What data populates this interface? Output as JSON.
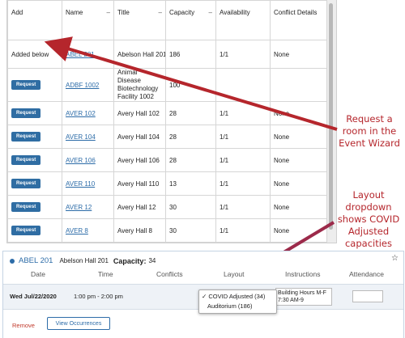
{
  "table": {
    "headers": [
      "Add",
      "Name",
      "Title",
      "Capacity",
      "Availability",
      "Conflict Details"
    ],
    "sort_marker": "–",
    "rows": [
      {
        "add": "Added below",
        "name": "ABEL 201",
        "title": "Abelson Hall 201",
        "capacity": "186",
        "availability": "1/1",
        "conflict": "None"
      },
      {
        "add": "Request",
        "name": "ADBF 1002",
        "title": "Animal Disease Biotechnology Facility 1002",
        "capacity": "100",
        "availability": "",
        "conflict": ""
      },
      {
        "add": "Request",
        "name": "AVER 102",
        "title": "Avery Hall 102",
        "capacity": "28",
        "availability": "1/1",
        "conflict": "None"
      },
      {
        "add": "Request",
        "name": "AVER 104",
        "title": "Avery Hall 104",
        "capacity": "28",
        "availability": "1/1",
        "conflict": "None"
      },
      {
        "add": "Request",
        "name": "AVER 106",
        "title": "Avery Hall 106",
        "capacity": "28",
        "availability": "1/1",
        "conflict": "None"
      },
      {
        "add": "Request",
        "name": "AVER 110",
        "title": "Avery Hall 110",
        "capacity": "13",
        "availability": "1/1",
        "conflict": "None"
      },
      {
        "add": "Request",
        "name": "AVER 12",
        "title": "Avery Hall 12",
        "capacity": "30",
        "availability": "1/1",
        "conflict": "None"
      },
      {
        "add": "Request",
        "name": "AVER 8",
        "title": "Avery Hall 8",
        "capacity": "30",
        "availability": "1/1",
        "conflict": "None"
      }
    ]
  },
  "annotations": {
    "request_note": "Request a room in the Event Wizard",
    "layout_note": "Layout dropdown shows COVID Adjusted capacities",
    "color": "#b5262c"
  },
  "selected": {
    "room": "ABEL 201",
    "title": "Abelson Hall 201",
    "capacity_label": "Capacity:",
    "capacity_value": "34",
    "columns": [
      "Date",
      "Time",
      "Conflicts",
      "Layout",
      "Instructions",
      "Attendance"
    ],
    "date": "Wed Jul/22/2020",
    "time": "1:00 pm - 2:00 pm",
    "instructions": "Building Hours M-F 7:30 AM-9",
    "layout_options": [
      {
        "label": "COVID Adjusted (34)",
        "selected": true,
        "mark": "✓"
      },
      {
        "label": "Auditorium (186)",
        "selected": false
      }
    ],
    "remove_label": "Remove",
    "view_occurrences_label": "View Occurrences"
  },
  "icons": {
    "room_icon": "dot-icon",
    "favorite_icon": "star-icon",
    "favorite_glyph": "☆"
  },
  "colors": {
    "link": "#2d6ca8",
    "request_button": "#2f6da3",
    "remove": "#c0392b",
    "row_highlight": "#eef2f7"
  }
}
